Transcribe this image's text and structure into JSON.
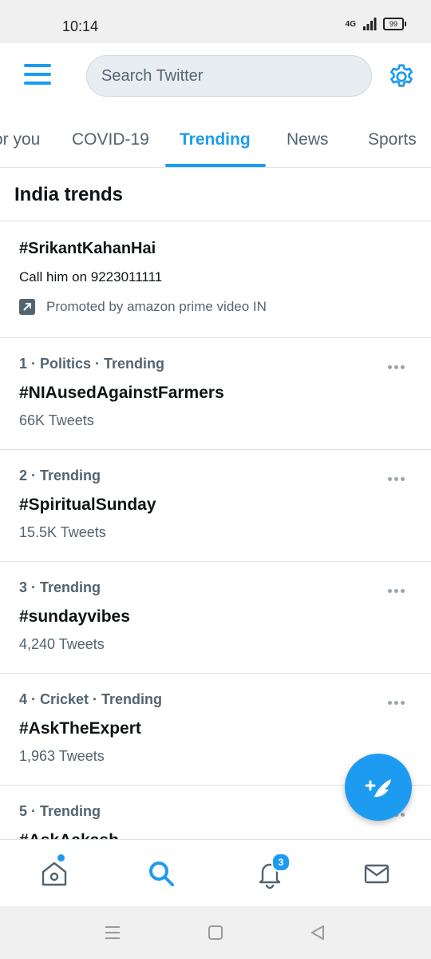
{
  "status_bar": {
    "time": "10:14",
    "network": "4G",
    "battery": "99"
  },
  "header": {
    "menu_icon": "hamburger-menu-icon",
    "search_placeholder": "Search Twitter",
    "settings_icon": "gear-icon"
  },
  "tabs": [
    {
      "label": "or you",
      "active": false
    },
    {
      "label": "COVID-19",
      "active": false
    },
    {
      "label": "Trending",
      "active": true
    },
    {
      "label": "News",
      "active": false
    },
    {
      "label": "Sports",
      "active": false
    }
  ],
  "section_title": "India trends",
  "promoted": {
    "tag": "#SrikantKahanHai",
    "description": "Call him on 9223011111",
    "promoted_by": "Promoted by amazon prime video IN"
  },
  "trends": [
    {
      "meta": "1 · Politics · Trending",
      "tag": "#NIAusedAgainstFarmers",
      "count": "66K Tweets"
    },
    {
      "meta": "2 · Trending",
      "tag": "#SpiritualSunday",
      "count": "15.5K Tweets"
    },
    {
      "meta": "3 · Trending",
      "tag": "#sundayvibes",
      "count": "4,240 Tweets"
    },
    {
      "meta": "4 · Cricket · Trending",
      "tag": "#AskTheExpert",
      "count": "1,963 Tweets"
    },
    {
      "meta": "5 · Trending",
      "tag": "#AskAakash",
      "count": ""
    }
  ],
  "bottom_nav": {
    "notification_count": "3"
  },
  "colors": {
    "accent": "#1d9bf0",
    "secondary_text": "#536471",
    "divider": "#dde3e7"
  }
}
